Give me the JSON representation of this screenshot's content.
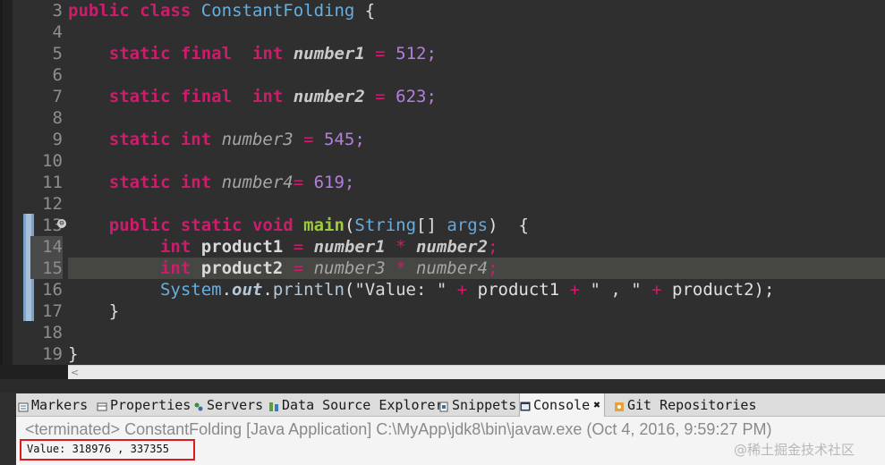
{
  "editor": {
    "line_numbers": [
      "3",
      "4",
      "5",
      "6",
      "7",
      "8",
      "9",
      "10",
      "11",
      "12",
      "13",
      "14",
      "15",
      "16",
      "17",
      "18",
      "19"
    ],
    "fold_marker": "⊖",
    "lines": [
      [
        {
          "t": "public",
          "c": "kw"
        },
        {
          "t": " ",
          "c": "pl"
        },
        {
          "t": "class",
          "c": "kw"
        },
        {
          "t": " ",
          "c": "pl"
        },
        {
          "t": "ConstantFolding",
          "c": "cls"
        },
        {
          "t": " {",
          "c": "pl"
        }
      ],
      [],
      [
        {
          "t": "    ",
          "c": "pl"
        },
        {
          "t": "static",
          "c": "kw"
        },
        {
          "t": " ",
          "c": "pl"
        },
        {
          "t": "final",
          "c": "kw"
        },
        {
          "t": "  ",
          "c": "pl"
        },
        {
          "t": "int",
          "c": "kw"
        },
        {
          "t": " ",
          "c": "pl"
        },
        {
          "t": "number1",
          "c": "fld-static"
        },
        {
          "t": " = ",
          "c": "op"
        },
        {
          "t": "512;",
          "c": "num"
        }
      ],
      [],
      [
        {
          "t": "    ",
          "c": "pl"
        },
        {
          "t": "static",
          "c": "kw"
        },
        {
          "t": " ",
          "c": "pl"
        },
        {
          "t": "final",
          "c": "kw"
        },
        {
          "t": "  ",
          "c": "pl"
        },
        {
          "t": "int",
          "c": "kw"
        },
        {
          "t": " ",
          "c": "pl"
        },
        {
          "t": "number2",
          "c": "fld-static"
        },
        {
          "t": " = ",
          "c": "op"
        },
        {
          "t": "623;",
          "c": "num"
        }
      ],
      [],
      [
        {
          "t": "    ",
          "c": "pl"
        },
        {
          "t": "static",
          "c": "kw"
        },
        {
          "t": " ",
          "c": "pl"
        },
        {
          "t": "int",
          "c": "kw"
        },
        {
          "t": " ",
          "c": "pl"
        },
        {
          "t": "number3",
          "c": "fld"
        },
        {
          "t": " = ",
          "c": "op"
        },
        {
          "t": "545;",
          "c": "num"
        }
      ],
      [],
      [
        {
          "t": "    ",
          "c": "pl"
        },
        {
          "t": "static",
          "c": "kw"
        },
        {
          "t": " ",
          "c": "pl"
        },
        {
          "t": "int",
          "c": "kw"
        },
        {
          "t": " ",
          "c": "pl"
        },
        {
          "t": "number4",
          "c": "fld"
        },
        {
          "t": "= ",
          "c": "op"
        },
        {
          "t": "619;",
          "c": "num"
        }
      ],
      [],
      [
        {
          "t": "    ",
          "c": "pl"
        },
        {
          "t": "public",
          "c": "kw"
        },
        {
          "t": " ",
          "c": "pl"
        },
        {
          "t": "static",
          "c": "kw"
        },
        {
          "t": " ",
          "c": "pl"
        },
        {
          "t": "void",
          "c": "kw"
        },
        {
          "t": " ",
          "c": "pl"
        },
        {
          "t": "main",
          "c": "meth"
        },
        {
          "t": "(",
          "c": "pl"
        },
        {
          "t": "String",
          "c": "cls"
        },
        {
          "t": "[] ",
          "c": "pl"
        },
        {
          "t": "args",
          "c": "param"
        },
        {
          "t": ")  {",
          "c": "pl"
        }
      ],
      [
        {
          "t": "         ",
          "c": "pl"
        },
        {
          "t": "int",
          "c": "kw"
        },
        {
          "t": " ",
          "c": "pl"
        },
        {
          "t": "product1",
          "c": "var"
        },
        {
          "t": " = ",
          "c": "op"
        },
        {
          "t": "number1",
          "c": "fld-static"
        },
        {
          "t": " * ",
          "c": "op"
        },
        {
          "t": "number2",
          "c": "fld-static"
        },
        {
          "t": ";",
          "c": "op"
        }
      ],
      [
        {
          "t": "         ",
          "c": "pl"
        },
        {
          "t": "int",
          "c": "kw"
        },
        {
          "t": " ",
          "c": "pl"
        },
        {
          "t": "product2",
          "c": "var"
        },
        {
          "t": " = ",
          "c": "op"
        },
        {
          "t": "number3",
          "c": "fld"
        },
        {
          "t": " * ",
          "c": "op"
        },
        {
          "t": "number4",
          "c": "fld"
        },
        {
          "t": ";",
          "c": "op"
        }
      ],
      [
        {
          "t": "         ",
          "c": "pl"
        },
        {
          "t": "System",
          "c": "cls"
        },
        {
          "t": ".",
          "c": "pl"
        },
        {
          "t": "out",
          "c": "out"
        },
        {
          "t": ".",
          "c": "pl"
        },
        {
          "t": "println",
          "c": "call"
        },
        {
          "t": "(",
          "c": "pl"
        },
        {
          "t": "\"Value: \"",
          "c": "str"
        },
        {
          "t": " + ",
          "c": "op"
        },
        {
          "t": "product1",
          "c": "pl"
        },
        {
          "t": " + ",
          "c": "op"
        },
        {
          "t": "\" , \"",
          "c": "str"
        },
        {
          "t": " + ",
          "c": "op"
        },
        {
          "t": "product2",
          "c": "pl"
        },
        {
          "t": ");",
          "c": "pl"
        }
      ],
      [
        {
          "t": "    }",
          "c": "pl"
        }
      ],
      [],
      [
        {
          "t": "}",
          "c": "pl"
        }
      ]
    ],
    "highlighted_line": "15",
    "scroll_arrow": "<"
  },
  "panel": {
    "tabs": [
      {
        "label": "Markers",
        "icon": "markers-icon"
      },
      {
        "label": "Properties",
        "icon": "properties-icon"
      },
      {
        "label": "Servers",
        "icon": "servers-icon"
      },
      {
        "label": "Data Source Explorer",
        "icon": "data-source-icon"
      },
      {
        "label": "Snippets",
        "icon": "snippets-icon"
      },
      {
        "label": "Console",
        "icon": "console-icon",
        "active": true,
        "close": "✖"
      },
      {
        "label": "Git Repositories",
        "icon": "git-icon"
      }
    ],
    "console_status": "<terminated> ConstantFolding [Java Application] C:\\MyApp\\jdk8\\bin\\javaw.exe (Oct 4, 2016, 9:59:27 PM)",
    "console_output": "Value: 318976 , 337355",
    "watermark": "@稀土掘金技术社区"
  },
  "colors": {
    "editor_bg": "#2f2f2f",
    "keyword": "#cc1d6d",
    "class": "#66afe0",
    "number": "#b47ee0",
    "method": "#9ccc3a",
    "highlight_box": "#e01a1a"
  }
}
